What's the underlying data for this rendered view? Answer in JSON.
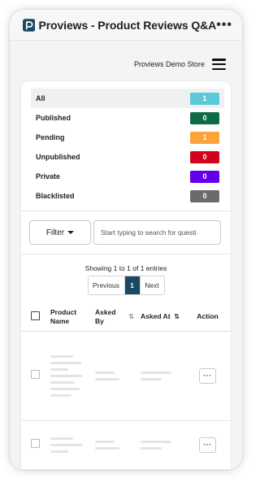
{
  "app": {
    "title": "Proviews - Product Reviews Q&A",
    "more_icon": "more-horizontal-icon",
    "logo_color": "#1b4965"
  },
  "store": {
    "name": "Proviews Demo Store",
    "menu_icon": "hamburger-menu-icon"
  },
  "statuses": [
    {
      "label": "All",
      "count": "1",
      "color": "#5bc8d8"
    },
    {
      "label": "Published",
      "count": "0",
      "color": "#0f6b47"
    },
    {
      "label": "Pending",
      "count": "1",
      "color": "#fba43a"
    },
    {
      "label": "Unpublished",
      "count": "0",
      "color": "#d0021b"
    },
    {
      "label": "Private",
      "count": "0",
      "color": "#6200ee"
    },
    {
      "label": "Blacklisted",
      "count": "0",
      "color": "#6b6b6b"
    }
  ],
  "filter": {
    "button_label": "Filter",
    "search_placeholder": "Start typing to search for questi"
  },
  "pagination": {
    "showing": "Showing 1 to 1 of 1 entries",
    "prev": "Previous",
    "current": "1",
    "next": "Next"
  },
  "table": {
    "columns": {
      "product": "Product Name",
      "asked_by": "Asked By",
      "asked_at": "Asked At",
      "action": "Action"
    },
    "action_label": "···"
  }
}
